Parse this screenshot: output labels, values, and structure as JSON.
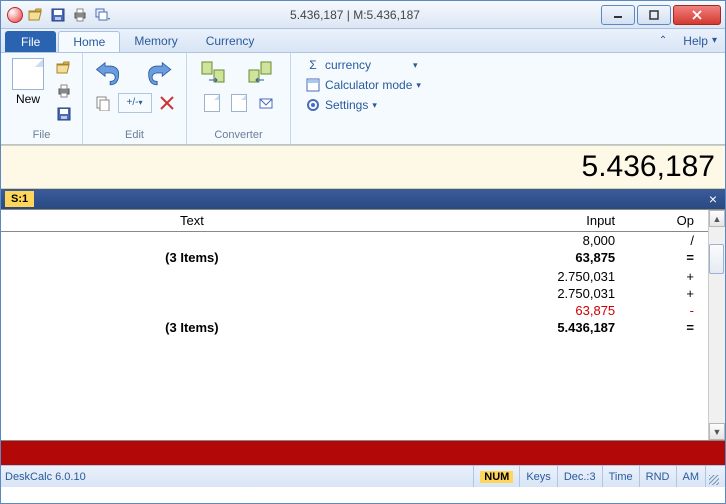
{
  "titlebar": {
    "title": "5.436,187 | M:5.436,187"
  },
  "menu": {
    "file": "File",
    "tabs": [
      "Home",
      "Memory",
      "Currency"
    ],
    "help": "Help"
  },
  "ribbon": {
    "file_group": {
      "new": "New",
      "label": "File"
    },
    "edit_group": {
      "plusminus": "+/-",
      "label": "Edit"
    },
    "converter_group": {
      "label": "Converter"
    },
    "settings_group": {
      "currency": "currency",
      "calcmode": "Calculator mode",
      "settings": "Settings"
    }
  },
  "display": "5.436,187",
  "strip": {
    "tab": "S:1"
  },
  "tape": {
    "headers": {
      "text": "Text",
      "input": "Input",
      "op": "Op"
    },
    "rows": [
      {
        "text": "",
        "input": "8,000",
        "op": "/",
        "style": ""
      },
      {
        "text": "(3 Items)",
        "input": "63,875",
        "op": "=",
        "style": "bold"
      },
      {
        "text": "",
        "input": "",
        "op": "",
        "style": ""
      },
      {
        "text": "",
        "input": "2.750,031",
        "op": "+",
        "style": ""
      },
      {
        "text": "",
        "input": "2.750,031",
        "op": "+",
        "style": ""
      },
      {
        "text": "",
        "input": "63,875",
        "op": "-",
        "style": "red"
      },
      {
        "text": "(3 Items)",
        "input": "5.436,187",
        "op": "=",
        "style": "bold"
      }
    ]
  },
  "status": {
    "product": "DeskCalc 6.0.10",
    "num": "NUM",
    "keys": "Keys",
    "dec": "Dec.:3",
    "time": "Time",
    "rnd": "RND",
    "am": "AM"
  }
}
